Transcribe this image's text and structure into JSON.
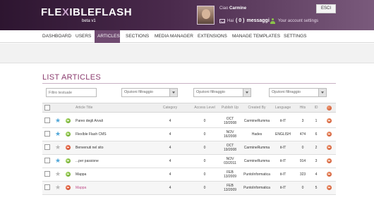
{
  "app": {
    "logo_text": "FLEXIBLEFLASH",
    "logo_prefix": "FLE",
    "logo_x": "X",
    "logo_suffix": "IBLEFLASH",
    "version": "beta v1"
  },
  "user": {
    "greeting": "Ciao",
    "name": "Carmine",
    "messages_prefix": "Hai",
    "messages_count": "( 0 )",
    "messages_label": "messaggi",
    "account_settings": "Your account settings",
    "exit_button": "ESCI"
  },
  "nav": {
    "items": [
      {
        "label": "DASHBOARD",
        "active": false
      },
      {
        "label": "USERS",
        "active": false
      },
      {
        "label": "ARTICLES",
        "active": true
      },
      {
        "label": "SECTIONS",
        "active": false
      },
      {
        "label": "MEDIA MANAGER",
        "active": false
      },
      {
        "label": "EXTENSIONS",
        "active": false
      },
      {
        "label": "MANAGE TEMPLATES",
        "active": false
      },
      {
        "label": "SETTINGS",
        "active": false
      }
    ]
  },
  "page": {
    "title": "LIST ARTICLES"
  },
  "filters": {
    "text_placeholder": "Filtro testuale",
    "select_1": "Opzioni filtraggio",
    "select_2": "Opzioni filtraggio",
    "select_3": "Opzioni filtraggio"
  },
  "table": {
    "headers": {
      "title": "Article Title",
      "category": "Category",
      "access": "Access Level",
      "published": "Publish Up",
      "created_by": "Created By",
      "language": "Language",
      "hits": "Hits",
      "id": "ID"
    },
    "rows": [
      {
        "starred": true,
        "status": "green",
        "title": "Pareo degli Arvali",
        "title_color": "normal",
        "category": "4",
        "access": "0",
        "date_1": "OCT",
        "date_2": "19/2008",
        "created_by": "CarmineRumma",
        "language": "it-IT",
        "hits": "3",
        "id": "1"
      },
      {
        "starred": true,
        "status": "green",
        "title": "FlexIble Flash CMS",
        "title_color": "normal",
        "category": "4",
        "access": "0",
        "date_1": "NOV",
        "date_2": "16/2008",
        "created_by": "Hades",
        "language": "ENGLISH",
        "hits": "474",
        "id": "6"
      },
      {
        "starred": false,
        "status": "red",
        "title": "Benvenuti nel sito",
        "title_color": "normal",
        "category": "4",
        "access": "0",
        "date_1": "OCT",
        "date_2": "19/2008",
        "created_by": "CarmineRumma",
        "language": "it-IT",
        "hits": "0",
        "id": "2"
      },
      {
        "starred": true,
        "status": "green",
        "title": "...per passione",
        "title_color": "normal",
        "category": "4",
        "access": "0",
        "date_1": "NOV",
        "date_2": "03/2011",
        "created_by": "CarmineRumma",
        "language": "it-IT",
        "hits": "914",
        "id": "3"
      },
      {
        "starred": false,
        "status": "green",
        "title": "Mappa",
        "title_color": "normal",
        "category": "4",
        "access": "0",
        "date_1": "FEB",
        "date_2": "13/2009",
        "created_by": "PuntoInformatica",
        "language": "it-IT",
        "hits": "323",
        "id": "4"
      },
      {
        "starred": false,
        "status": "red",
        "title": "Mappa",
        "title_color": "pink",
        "category": "4",
        "access": "0",
        "date_1": "FEB",
        "date_2": "13/2009",
        "created_by": "PuntoInformatica",
        "language": "it-IT",
        "hits": "0",
        "id": "5"
      }
    ]
  },
  "colors": {
    "accent": "#6f4a70",
    "title": "#8b3b6e",
    "star_on": "#4fa6d8",
    "status_green": "#5a9a18",
    "status_red": "#c5331a"
  }
}
